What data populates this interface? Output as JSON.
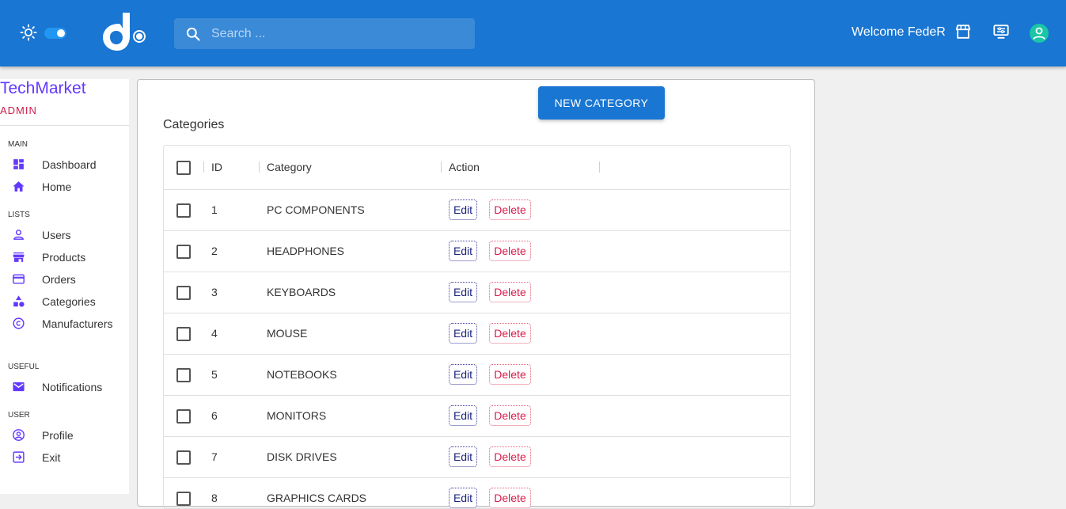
{
  "header": {
    "search_placeholder": "Search ...",
    "welcome": "Welcome FedeR",
    "icons": [
      "sun-icon",
      "theme-toggle",
      "moon-icon",
      "logo",
      "search-icon",
      "store-icon",
      "monitor-icon",
      "account-icon"
    ]
  },
  "sidebar": {
    "brand": "TechMarket",
    "brand_sub": "ADMIN",
    "sections": [
      {
        "title": "MAIN",
        "items": [
          {
            "label": "Dashboard",
            "icon": "dashboard-icon"
          },
          {
            "label": "Home",
            "icon": "home-icon"
          }
        ]
      },
      {
        "title": "LISTS",
        "items": [
          {
            "label": "Users",
            "icon": "user-icon"
          },
          {
            "label": "Products",
            "icon": "store-icon"
          },
          {
            "label": "Orders",
            "icon": "credit-card-icon"
          },
          {
            "label": "Categories",
            "icon": "category-icon"
          },
          {
            "label": "Manufacturers",
            "icon": "copyright-icon"
          }
        ]
      },
      {
        "title": "USEFUL",
        "items": [
          {
            "label": "Notifications",
            "icon": "mail-icon"
          }
        ]
      },
      {
        "title": "USER",
        "items": [
          {
            "label": "Profile",
            "icon": "profile-icon"
          },
          {
            "label": "Exit",
            "icon": "exit-icon"
          }
        ]
      }
    ]
  },
  "main": {
    "new_button": "NEW CATEGORY",
    "title": "Categories",
    "columns": [
      "ID",
      "Category",
      "Action"
    ],
    "edit_label": "Edit",
    "delete_label": "Delete",
    "rows": [
      {
        "id": "1",
        "category": "PC COMPONENTS"
      },
      {
        "id": "2",
        "category": "HEADPHONES"
      },
      {
        "id": "3",
        "category": "KEYBOARDS"
      },
      {
        "id": "4",
        "category": "MOUSE"
      },
      {
        "id": "5",
        "category": "NOTEBOOKS"
      },
      {
        "id": "6",
        "category": "MONITORS"
      },
      {
        "id": "7",
        "category": "DISK DRIVES"
      },
      {
        "id": "8",
        "category": "GRAPHICS CARDS"
      }
    ]
  },
  "colors": {
    "topbar": "#1976d2",
    "brand": "#6439ff",
    "brand_sub": "#cf1d4a",
    "icon": "#6439ff",
    "delete": "#d81b4a",
    "edit": "#1a237e"
  }
}
